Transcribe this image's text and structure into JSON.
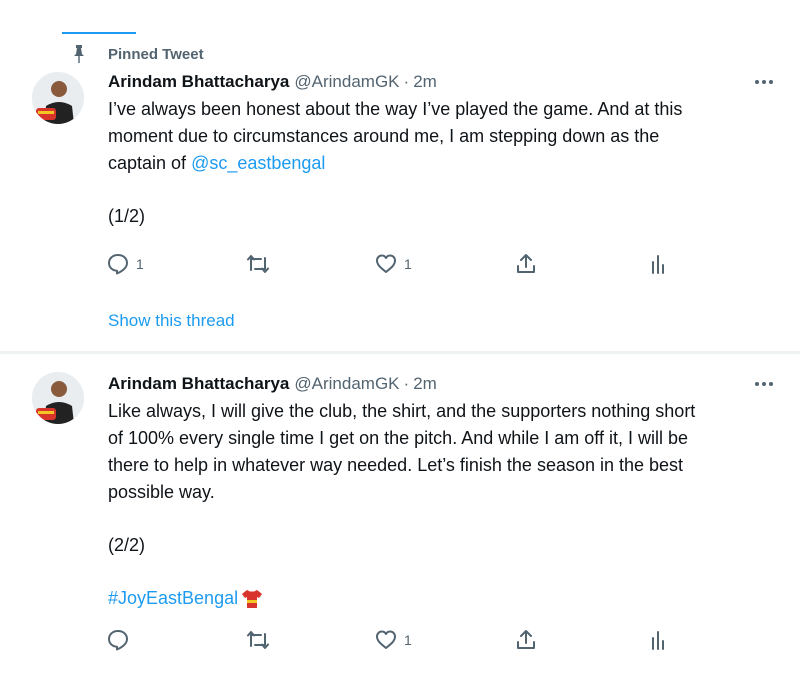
{
  "pinned": {
    "label": "Pinned Tweet"
  },
  "tweets": [
    {
      "name": "Arindam Bhattacharya",
      "handle": "@ArindamGK",
      "separator": "·",
      "time": "2m",
      "text_lines": [
        "I’ve always been honest about the way I’ve played the game. And at this",
        "moment due to circumstances around me, I am stepping down as the"
      ],
      "text_last_prefix": "captain of ",
      "mention": "@sc_eastbengal",
      "thread_count": "(1/2)",
      "reply_count": "1",
      "like_count": "1",
      "show_thread": "Show this thread"
    },
    {
      "name": "Arindam Bhattacharya",
      "handle": "@ArindamGK",
      "separator": "·",
      "time": "2m",
      "text_lines": [
        "Like always, I will give the club, the shirt, and the supporters nothing short",
        "of 100% every single time I get on the pitch. And while I am off it, I will be",
        "there to help in whatever way needed. Let’s finish the season in the best",
        "possible way."
      ],
      "thread_count": "(2/2)",
      "hashtag": "#JoyEastBengal",
      "like_count": "1"
    }
  ],
  "colors": {
    "accent": "#1d9bf0",
    "secondary": "#536471",
    "text": "#0f1419"
  }
}
